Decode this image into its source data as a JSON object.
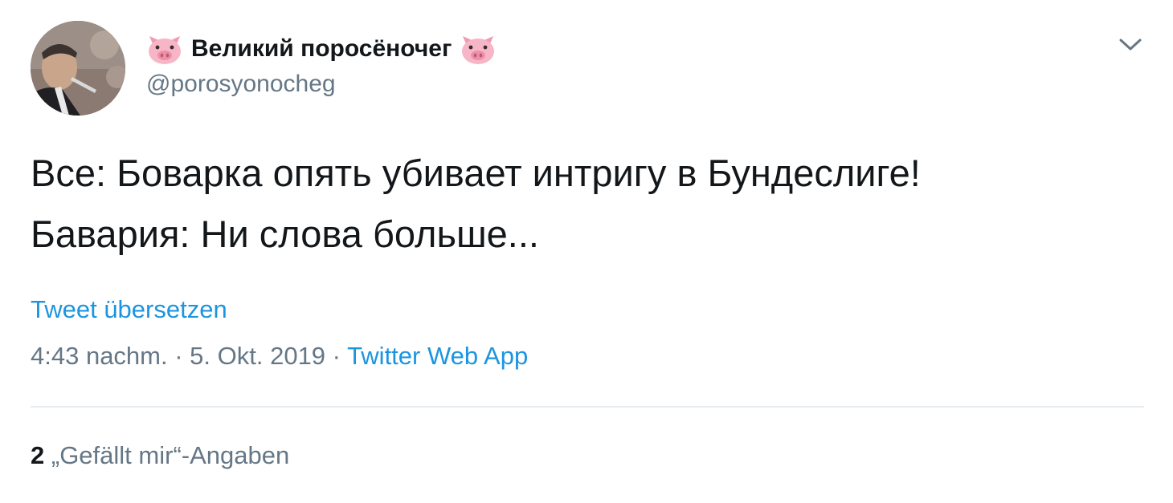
{
  "author": {
    "display_name": "Великий поросёночег",
    "handle": "@porosyonocheg",
    "name_prefix_icon": "pig-face-icon",
    "name_suffix_icon": "pig-face-icon"
  },
  "tweet": {
    "lines": [
      "Все: Боварка опять убивает интригу в Бундеслиге!",
      "Бавария: Ни слова больше..."
    ],
    "translate_label": "Tweet übersetzen",
    "time": "4:43 nachm.",
    "separator": " · ",
    "date": "5. Okt. 2019",
    "source": "Twitter Web App"
  },
  "stats": {
    "likes_count": "2",
    "likes_label": "„Gefällt mir“-Angaben"
  },
  "menu": {
    "icon": "chevron-down-icon"
  },
  "colors": {
    "text": "#14171a",
    "secondary": "#657786",
    "link": "#1b95e0",
    "divider": "#e6ecf0"
  }
}
